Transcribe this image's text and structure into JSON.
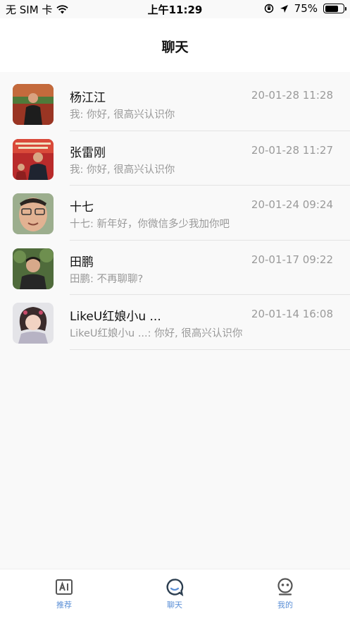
{
  "status_bar": {
    "carrier": "无 SIM 卡",
    "time": "上午11:29",
    "battery_percent": "75%",
    "battery_level": 0.75
  },
  "header": {
    "title": "聊天"
  },
  "chats": [
    {
      "name": "杨江江",
      "time": "20-01-28 11:28",
      "preview": "我: 你好, 很高兴认识你"
    },
    {
      "name": "张雷刚",
      "time": "20-01-28 11:27",
      "preview": "我: 你好, 很高兴认识你"
    },
    {
      "name": "十七",
      "time": "20-01-24 09:24",
      "preview": "十七: 新年好，你微信多少我加你吧"
    },
    {
      "name": "田鹏",
      "time": "20-01-17 09:22",
      "preview": "田鹏: 不再聊聊?"
    },
    {
      "name": "LikeU红娘小u ...",
      "time": "20-01-14 16:08",
      "preview": "LikeU红娘小u ...: 你好, 很高兴认识你"
    }
  ],
  "tabs": [
    {
      "label": "推荐",
      "icon": "ai-icon"
    },
    {
      "label": "聊天",
      "icon": "chat-bubble-icon",
      "active": true
    },
    {
      "label": "我的",
      "icon": "profile-face-icon"
    }
  ],
  "colors": {
    "accent": "#5b8fd6",
    "active_tab": "#2c3e50"
  }
}
